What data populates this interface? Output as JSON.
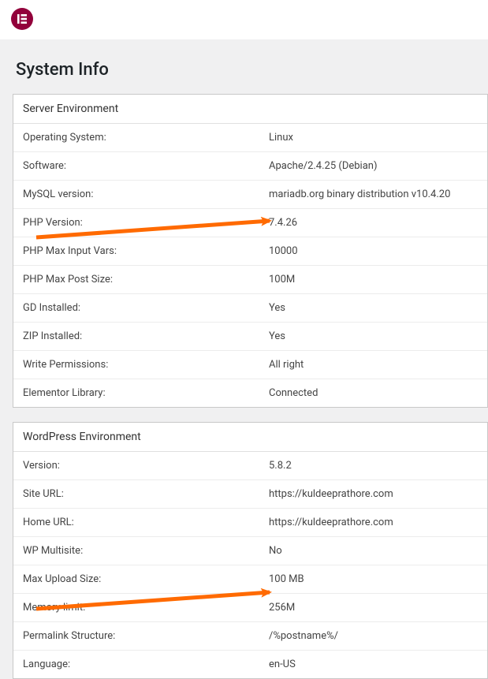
{
  "page": {
    "title": "System Info"
  },
  "server_env": {
    "heading": "Server Environment",
    "rows": {
      "os": {
        "label": "Operating System:",
        "value": "Linux"
      },
      "software": {
        "label": "Software:",
        "value": "Apache/2.4.25 (Debian)"
      },
      "mysql": {
        "label": "MySQL version:",
        "value": "mariadb.org binary distribution v10.4.20"
      },
      "php_version": {
        "label": "PHP Version:",
        "value": "7.4.26"
      },
      "php_max_input": {
        "label": "PHP Max Input Vars:",
        "value": "10000"
      },
      "php_max_post": {
        "label": "PHP Max Post Size:",
        "value": "100M"
      },
      "gd": {
        "label": "GD Installed:",
        "value": "Yes"
      },
      "zip": {
        "label": "ZIP Installed:",
        "value": "Yes"
      },
      "write_perms": {
        "label": "Write Permissions:",
        "value": "All right"
      },
      "library": {
        "label": "Elementor Library:",
        "value": "Connected"
      }
    }
  },
  "wp_env": {
    "heading": "WordPress Environment",
    "rows": {
      "version": {
        "label": "Version:",
        "value": "5.8.2"
      },
      "site_url": {
        "label": "Site URL:",
        "value": "https://kuldeeprathore.com"
      },
      "home_url": {
        "label": "Home URL:",
        "value": "https://kuldeeprathore.com"
      },
      "multisite": {
        "label": "WP Multisite:",
        "value": "No"
      },
      "max_upload": {
        "label": "Max Upload Size:",
        "value": "100 MB"
      },
      "memory_limit": {
        "label": "Memory limit:",
        "value": "256M"
      },
      "permalink": {
        "label": "Permalink Structure:",
        "value": "/%postname%/"
      },
      "language": {
        "label": "Language:",
        "value": "en-US"
      }
    }
  },
  "annotation_arrows": {
    "color": "#ff6a00"
  }
}
